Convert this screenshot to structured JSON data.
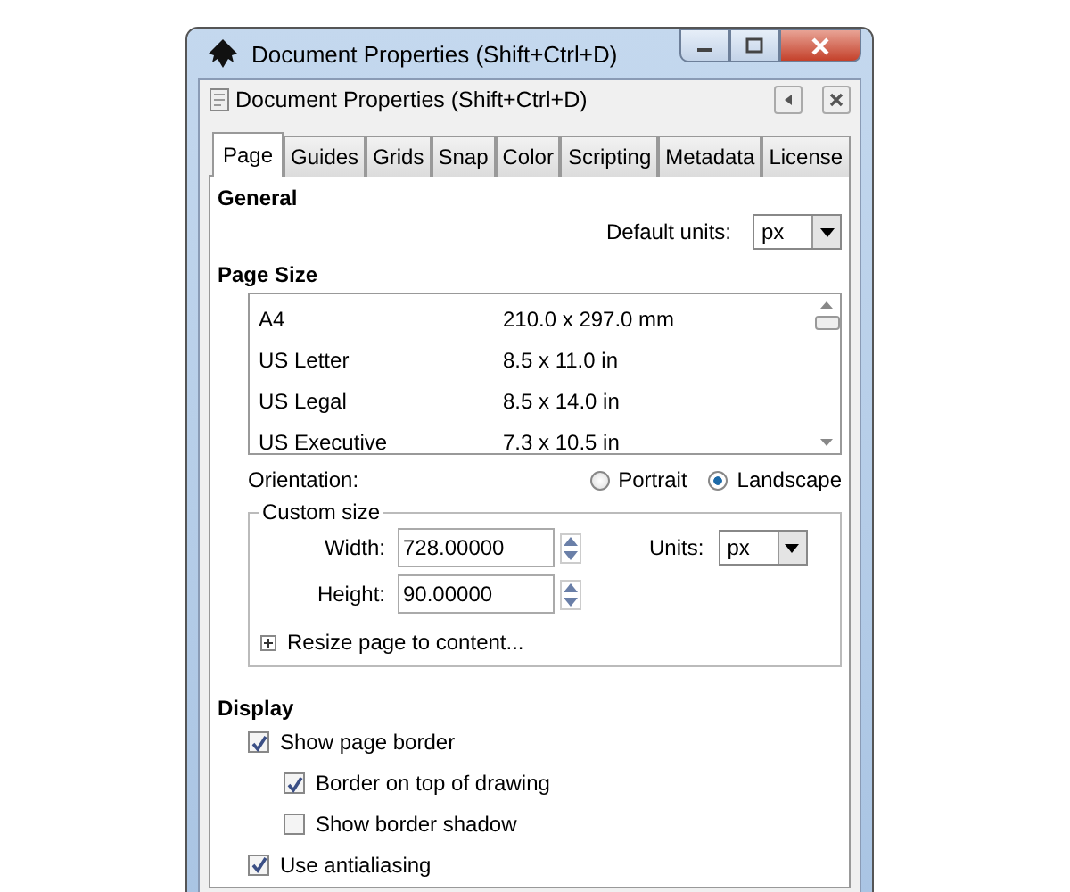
{
  "window": {
    "title": "Document Properties (Shift+Ctrl+D)"
  },
  "dialog": {
    "title": "Document Properties (Shift+Ctrl+D)"
  },
  "tabs": [
    {
      "label": "Page",
      "selected": true
    },
    {
      "label": "Guides",
      "selected": false
    },
    {
      "label": "Grids",
      "selected": false
    },
    {
      "label": "Snap",
      "selected": false
    },
    {
      "label": "Color",
      "selected": false
    },
    {
      "label": "Scripting",
      "selected": false
    },
    {
      "label": "Metadata",
      "selected": false
    },
    {
      "label": "License",
      "selected": false
    }
  ],
  "general": {
    "heading": "General",
    "default_units_label": "Default units:",
    "default_units_value": "px"
  },
  "page_size": {
    "heading": "Page Size",
    "rows": [
      {
        "name": "A4",
        "size": "210.0 x 297.0 mm"
      },
      {
        "name": "US Letter",
        "size": "8.5 x 11.0 in"
      },
      {
        "name": "US Legal",
        "size": "8.5 x 14.0 in"
      },
      {
        "name": "US Executive",
        "size": "7.3 x 10.5 in"
      }
    ],
    "orientation_label": "Orientation:",
    "orientation_options": [
      {
        "label": "Portrait",
        "selected": false
      },
      {
        "label": "Landscape",
        "selected": true
      }
    ],
    "custom_size": {
      "legend": "Custom size",
      "width_label": "Width:",
      "width_value": "728.00000",
      "height_label": "Height:",
      "height_value": "90.00000",
      "units_label": "Units:",
      "units_value": "px",
      "resize_label": "Resize page to content..."
    }
  },
  "display": {
    "heading": "Display",
    "options": [
      {
        "label": "Show page border",
        "checked": true,
        "children": [
          {
            "label": "Border on top of drawing",
            "checked": true
          },
          {
            "label": "Show border shadow",
            "checked": false
          }
        ]
      },
      {
        "label": "Use antialiasing",
        "checked": true
      }
    ]
  }
}
